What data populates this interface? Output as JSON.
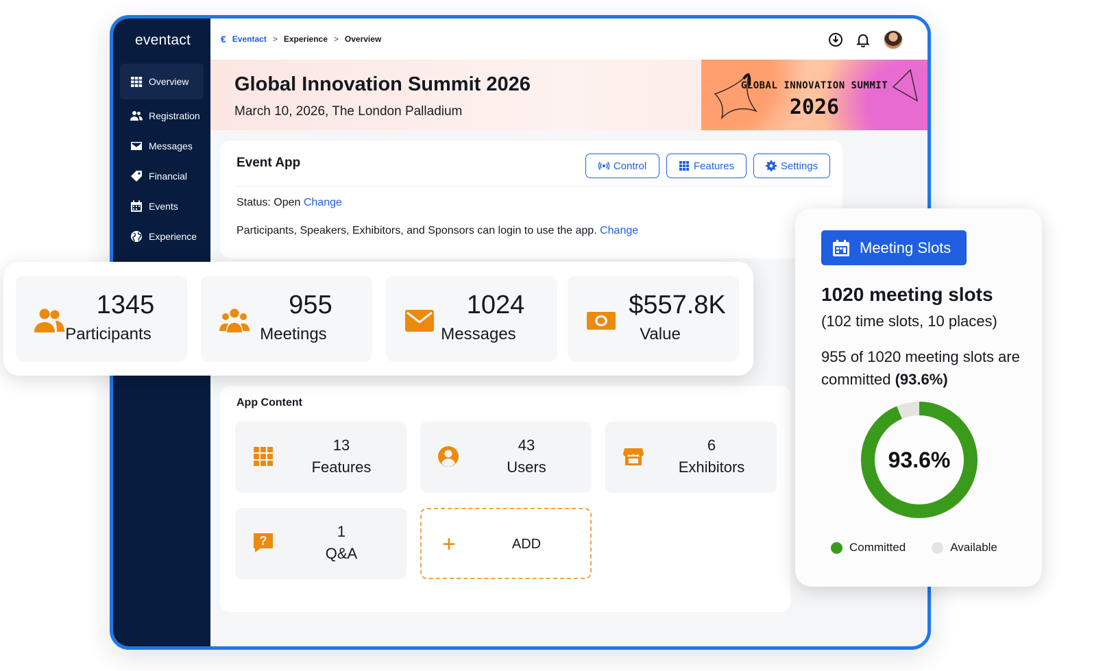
{
  "brand": "eventact",
  "sidebar": {
    "items": [
      {
        "label": "Overview",
        "icon": "grid-icon"
      },
      {
        "label": "Registration",
        "icon": "users-icon"
      },
      {
        "label": "Messages",
        "icon": "envelope-icon"
      },
      {
        "label": "Financial",
        "icon": "tag-icon"
      },
      {
        "label": "Events",
        "icon": "calendar-icon"
      },
      {
        "label": "Experience",
        "icon": "globe-icon"
      }
    ],
    "active": "Overview"
  },
  "breadcrumb": {
    "logo": "€",
    "items": [
      "Eventact",
      "Experience",
      "Overview"
    ],
    "separator": ">"
  },
  "event": {
    "title": "Global Innovation Summit 2026",
    "subtitle": "March 10, 2026, The London Palladium",
    "art_line1": "GLOBAL INNOVATION SUMMIT",
    "art_line2": "2026"
  },
  "event_app": {
    "title": "Event App",
    "buttons": {
      "control": "Control",
      "features": "Features",
      "settings": "Settings"
    },
    "status_prefix": "Status: Open",
    "status_link": "Change",
    "access_text": "Participants, Speakers, Exhibitors, and Sponsors can login to use the app.",
    "access_link": "Change"
  },
  "stats": [
    {
      "value": "1345",
      "label": "Participants",
      "icon": "users-icon"
    },
    {
      "value": "955",
      "label": "Meetings",
      "icon": "group-icon"
    },
    {
      "value": "1024",
      "label": "Messages",
      "icon": "envelope-icon"
    },
    {
      "value": "$557.8K",
      "label": "Value",
      "icon": "money-icon"
    }
  ],
  "app_content": {
    "title": "App Content",
    "tiles": [
      {
        "value": "13",
        "label": "Features",
        "icon": "apps-grid-icon"
      },
      {
        "value": "43",
        "label": "Users",
        "icon": "user-circle-icon"
      },
      {
        "value": "6",
        "label": "Exhibitors",
        "icon": "storefront-icon"
      },
      {
        "value": "1",
        "label": "Q&A",
        "icon": "question-bubble-icon"
      }
    ],
    "add_label": "ADD",
    "add_symbol": "+"
  },
  "meeting_slots": {
    "badge": "Meeting Slots",
    "headline": "1020 meeting slots",
    "sub": "(102 time slots, 10 places)",
    "desc_prefix": "955 of 1020 meeting slots are committed",
    "desc_percent": "(93.6%)",
    "center_label": "93.6%",
    "legend": {
      "committed": "Committed",
      "available": "Available"
    },
    "colors": {
      "committed": "#3a9a1c",
      "available": "#e3e3e0"
    }
  },
  "chart_data": {
    "type": "pie",
    "categories": [
      "Committed",
      "Available"
    ],
    "values": [
      955,
      65
    ],
    "percent_committed": 93.6
  },
  "colors": {
    "accent": "#1f5fe0",
    "orange": "#ec8a0e",
    "sidebar": "#071c3f",
    "frame": "#1f78e6"
  }
}
